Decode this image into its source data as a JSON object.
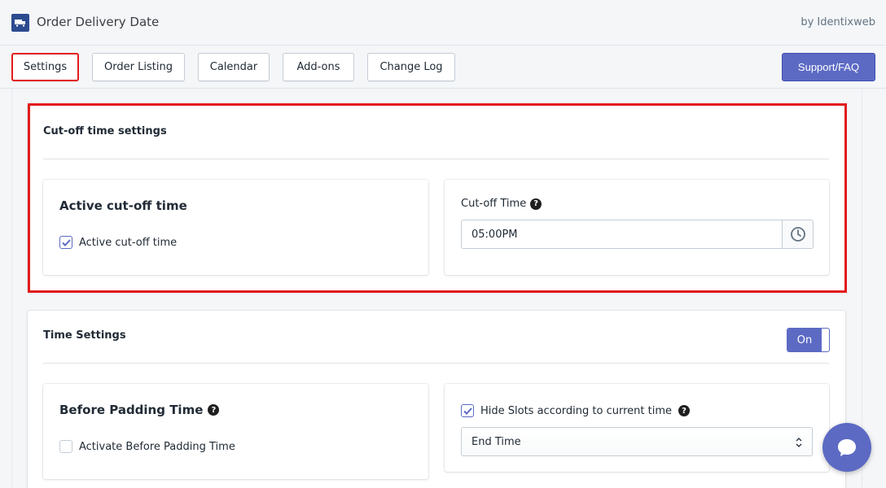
{
  "app": {
    "title": "Order Delivery Date",
    "vendor": "by Identixweb",
    "logo_icon": "delivery-truck-icon"
  },
  "nav": {
    "tabs": [
      {
        "label": "Settings",
        "active": true
      },
      {
        "label": "Order Listing",
        "active": false
      },
      {
        "label": "Calendar",
        "active": false
      },
      {
        "label": "Add-ons",
        "active": false
      },
      {
        "label": "Change Log",
        "active": false
      }
    ],
    "support_label": "Support/FAQ"
  },
  "colors": {
    "accent": "#5c6ac4",
    "highlight": "#e31b1b"
  },
  "cutoff": {
    "title": "Cut-off time settings",
    "active_card_title": "Active cut-off time",
    "active_checkbox_label": "Active cut-off time",
    "active_checked": true,
    "time_label": "Cut-off Time",
    "time_value": "05:00PM",
    "time_icon": "clock-icon"
  },
  "time_settings": {
    "title": "Time Settings",
    "toggle_label": "On",
    "toggle_on": true,
    "before_padding_title": "Before Padding Time",
    "before_padding_checkbox_label": "Activate Before Padding Time",
    "before_padding_checked": false,
    "hide_slots_label": "Hide Slots according to current time",
    "hide_slots_checked": true,
    "slot_select_value": "End Time"
  }
}
